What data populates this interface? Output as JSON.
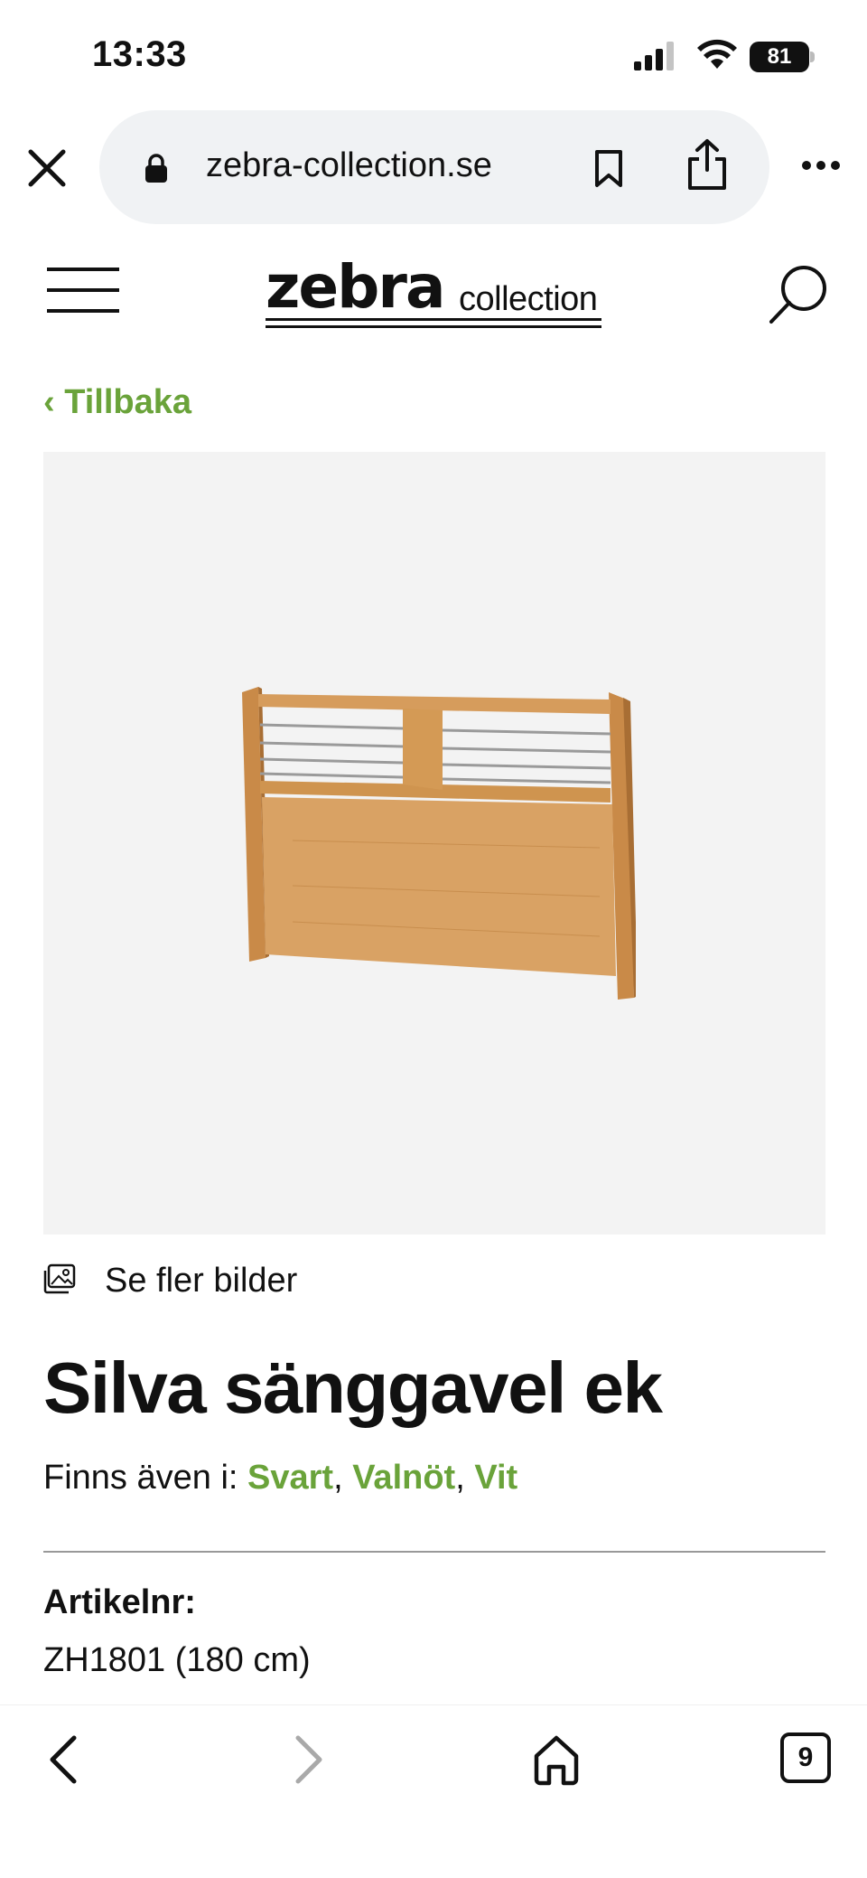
{
  "status_bar": {
    "time": "13:33",
    "battery": "81"
  },
  "browser": {
    "url": "zebra-collection.se",
    "tab_count": "9"
  },
  "site": {
    "logo_main": "zebra",
    "logo_sub": "collection",
    "back_label": "‹ Tillbaka"
  },
  "product": {
    "more_images_label": "Se fler bilder",
    "title": "Silva sänggavel ek",
    "variants_prefix": "Finns även i: ",
    "variants": [
      "Svart",
      "Valnöt",
      "Vit"
    ],
    "variant_separator": ", ",
    "article_label": "Artikelnr:",
    "article_value": "ZH1801 (180 cm)"
  },
  "colors": {
    "accent_green": "#6aa33a",
    "url_bar_bg": "#f0f2f4",
    "image_bg": "#f3f3f3",
    "wood": "#d49a55"
  },
  "icons": [
    "close-icon",
    "lock-icon",
    "bookmark-icon",
    "share-icon",
    "more-icon",
    "menu-icon",
    "search-icon",
    "gallery-icon",
    "back-arrow-icon",
    "forward-arrow-icon",
    "home-icon",
    "tabs-icon"
  ]
}
